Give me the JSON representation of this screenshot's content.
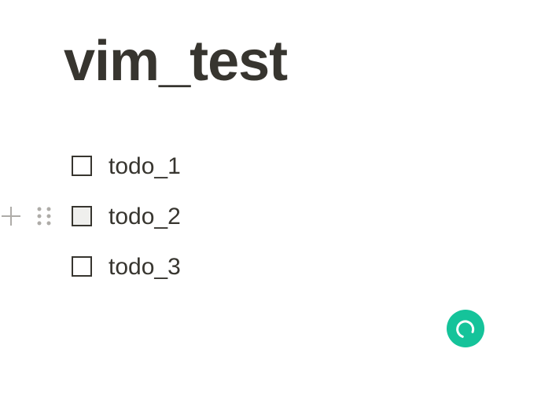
{
  "page": {
    "title": "vim_test"
  },
  "todos": [
    {
      "label": "todo_1",
      "checked": false
    },
    {
      "label": "todo_2",
      "checked": false
    },
    {
      "label": "todo_3",
      "checked": false
    }
  ],
  "block_controls": {
    "add_icon": "plus-icon",
    "drag_icon": "drag-handle-icon"
  },
  "assistant": {
    "icon": "circle-arc-icon",
    "color": "#15c39a"
  },
  "colors": {
    "text": "#37352f",
    "control_gray": "#aeaca8",
    "hover_fill": "#efefed"
  }
}
